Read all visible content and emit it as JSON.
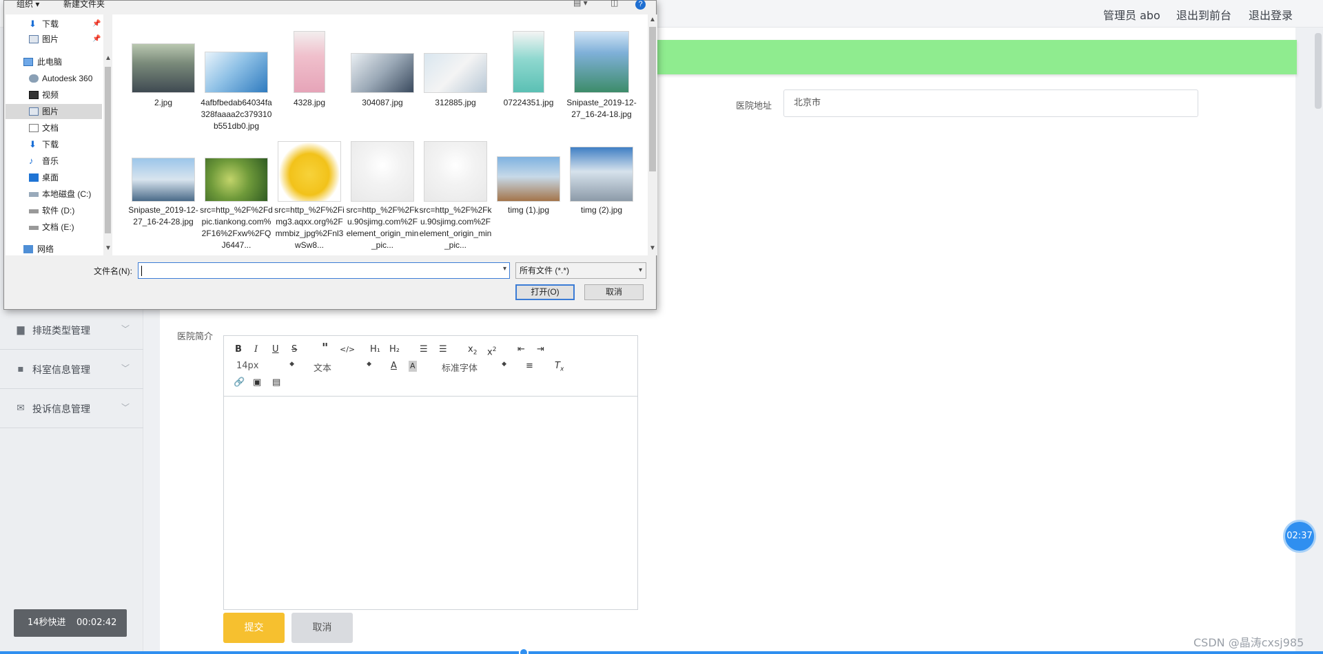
{
  "header": {
    "admin_label": "管理员 abo",
    "front_link": "退出到前台",
    "logout_link": "退出登录"
  },
  "sidebar": {
    "items": [
      {
        "label": "排班类型管理",
        "icon": "calendar-icon"
      },
      {
        "label": "科室信息管理",
        "icon": "chat-icon"
      },
      {
        "label": "投诉信息管理",
        "icon": "mail-icon"
      }
    ]
  },
  "form": {
    "address_label": "医院地址",
    "address_value": "北京市",
    "intro_label": "医院简介",
    "submit_label": "提交",
    "cancel_label": "取消"
  },
  "editor": {
    "font_size": "14px",
    "paragraph": "文本",
    "font_family": "标准字体",
    "h1": "H₁",
    "h2": "H₂"
  },
  "video": {
    "speed_label": "14秒快进",
    "time": "00:02:42",
    "timer": "02:37"
  },
  "watermark": "CSDN @晶涛cxsj985",
  "dialog": {
    "toolbar": {
      "organize": "组织 ▾",
      "new_folder": "新建文件夹"
    },
    "nav": [
      {
        "label": "下载",
        "icon": "download-icon",
        "pinned": true
      },
      {
        "label": "图片",
        "icon": "pictures-icon",
        "pinned": true
      },
      {
        "label": "此电脑",
        "icon": "computer-icon"
      },
      {
        "label": "Autodesk 360",
        "icon": "cloud-icon"
      },
      {
        "label": "视频",
        "icon": "video-icon"
      },
      {
        "label": "图片",
        "icon": "pictures-icon",
        "selected": true
      },
      {
        "label": "文档",
        "icon": "document-icon"
      },
      {
        "label": "下载",
        "icon": "download-icon"
      },
      {
        "label": "音乐",
        "icon": "music-icon"
      },
      {
        "label": "桌面",
        "icon": "desktop-icon"
      },
      {
        "label": "本地磁盘 (C:)",
        "icon": "drive-icon"
      },
      {
        "label": "软件 (D:)",
        "icon": "drive-icon"
      },
      {
        "label": "文档 (E:)",
        "icon": "drive-icon"
      },
      {
        "label": "网络",
        "icon": "network-icon"
      }
    ],
    "files": [
      {
        "name": "2.jpg"
      },
      {
        "name": "4afbfbedab64034fa328faaaa2c379310b551db0.jpg"
      },
      {
        "name": "4328.jpg"
      },
      {
        "name": "304087.jpg"
      },
      {
        "name": "312885.jpg"
      },
      {
        "name": "07224351.jpg"
      },
      {
        "name": "Snipaste_2019-12-27_16-24-18.jpg"
      },
      {
        "name": "Snipaste_2019-12-27_16-24-28.jpg"
      },
      {
        "name": "src=http_%2F%2Fdpic.tiankong.com%2F16%2Fxw%2FQJ6447..."
      },
      {
        "name": "src=http_%2F%2Fimg3.aqxx.org%2Fmmbiz_jpg%2Fnl3wSw8..."
      },
      {
        "name": "src=http_%2F%2Fku.90sjimg.com%2Felement_origin_min_pic..."
      },
      {
        "name": "src=http_%2F%2Fku.90sjimg.com%2Felement_origin_min_pic..."
      },
      {
        "name": "timg (1).jpg"
      },
      {
        "name": "timg (2).jpg"
      }
    ],
    "filename_label": "文件名(N):",
    "filename_value": "",
    "filter_value": "所有文件 (*.*)",
    "open_label": "打开(O)",
    "cancel_label": "取消"
  }
}
